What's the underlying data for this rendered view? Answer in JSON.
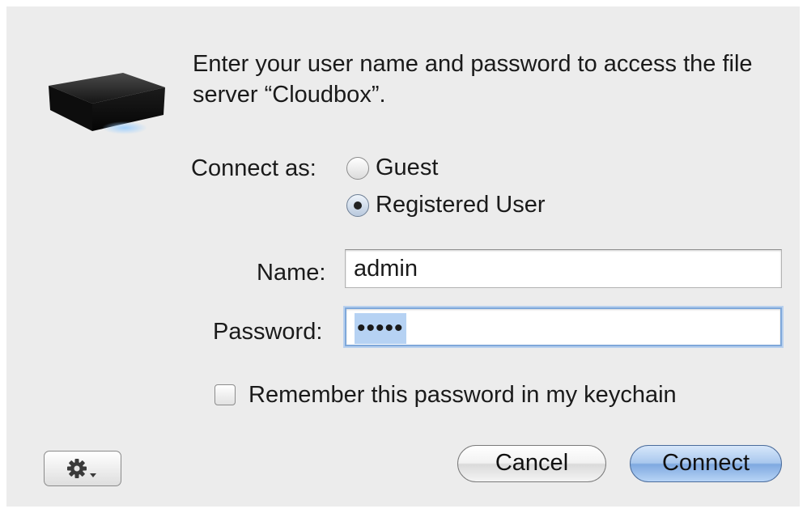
{
  "dialog": {
    "message": "Enter your user name and password to access the file server “Cloudbox”.",
    "server_icon": "network-storage-box-icon",
    "connect_as_label": "Connect as:",
    "options": [
      {
        "label": "Guest",
        "selected": false
      },
      {
        "label": "Registered User",
        "selected": true
      }
    ],
    "name_label": "Name:",
    "name_value": "admin",
    "password_label": "Password:",
    "password_value": "•••••",
    "remember_label": "Remember this password in my keychain",
    "remember_checked": false,
    "action_icon": "gear-icon",
    "cancel_label": "Cancel",
    "connect_label": "Connect",
    "colors": {
      "background": "#ececec",
      "focus_ring": "#7fa8da",
      "default_button": "#a9c8ee"
    }
  }
}
